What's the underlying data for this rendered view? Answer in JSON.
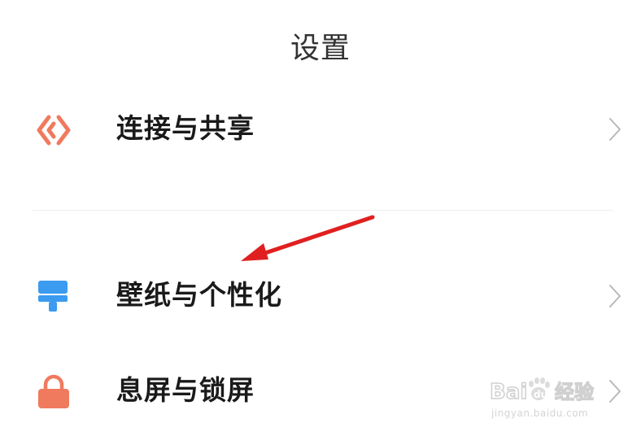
{
  "header": {
    "title": "设置"
  },
  "settings": {
    "items": [
      {
        "label": "连接与共享",
        "icon": "connection-share-icon",
        "icon_color": "#F07A5E"
      },
      {
        "label": "壁纸与个性化",
        "icon": "paint-brush-icon",
        "icon_color": "#3B9BF0"
      },
      {
        "label": "息屏与锁屏",
        "icon": "lock-icon",
        "icon_color": "#F07A5E"
      }
    ],
    "chevron_icon": "chevron-right-icon"
  },
  "annotation": {
    "icon": "red-arrow-icon",
    "color": "#E02020"
  },
  "watermark": {
    "logo_text": "Baidu经验",
    "url": "jingyan.baidu.com",
    "color": "#D0D0D0"
  }
}
